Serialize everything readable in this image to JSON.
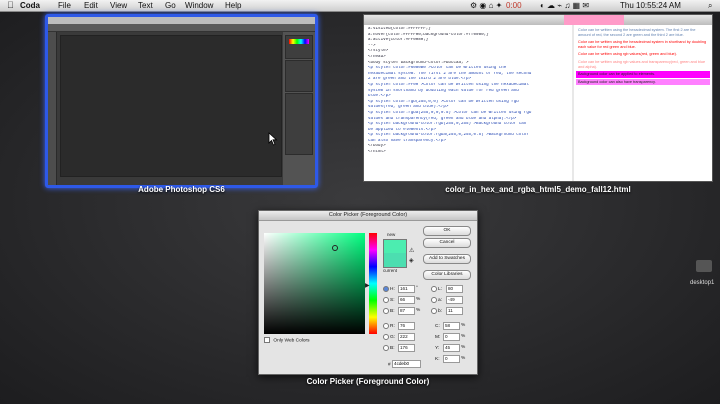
{
  "menubar": {
    "app": "Coda",
    "items": [
      "File",
      "Edit",
      "View",
      "Text",
      "Go",
      "Window",
      "Help"
    ],
    "status_text": "0:00",
    "clock": "Thu 10:55:24 AM"
  },
  "windows": {
    "photoshop": {
      "label": "Adobe Photoshop CS6"
    },
    "browser": {
      "label": "color_in_hex_and_rgba_html5_demo_fall12.html"
    }
  },
  "code_lines": [
    "a:visited{color:#FFFFFF;}",
    "a:hover{color:#FFFF00;background-color:#ff0080;}",
    "a:active{color:#FF0080;}",
    "-->",
    "</style>",
    "</head>",
    "<body style=\"background-color:#bbccaa;\">",
    "",
    "<p style=\"color:#6080B0\">Color can be written using the",
    "hexadecimal system. The first 2 are the amount of red, the second",
    "2 are green and the third 2 are blue.</p>",
    "",
    "<p style=\"color:#F00\">Color can be written using the hexadecimal",
    "system in shorthand by doubling each value for red green and",
    "blue.</p>",
    "",
    "<p style=\"color:rgb(255,0,0)\">Color can be written using rgb",
    "values(red, green and blue).</p>",
    "",
    "<p style=\"color:rgba(255,0,0,0.5)\">Color can be written using rgb",
    "values and transparency(red, green and blue and alpha).</p>",
    "",
    "<p style=\"background-color:rgb(255,0,255)\">Background color can",
    "be applied to elements.</p>",
    "",
    "<p style=\"background-color:rgba(255,0,255,0.5)\">Background color",
    "can also have transparency.</p>",
    "</body>",
    "</html>"
  ],
  "preview": [
    {
      "text": "Color can be written using the hexadecimal system. The first 2 are the amount of red, the second 2 are green and the third 2 are blue.",
      "color": "#6080b0",
      "bg": ""
    },
    {
      "text": "Color can be written using the hexadecimal system in shorthand by doubling each value for red green and blue.",
      "color": "#ff0000",
      "bg": ""
    },
    {
      "text": "Color can be written using rgb values(red, green and blue).",
      "color": "#ff0000",
      "bg": ""
    },
    {
      "text": "Color can be written using rgb values and transparency(red, green and blue and alpha).",
      "color": "#ff8080",
      "bg": ""
    },
    {
      "text": "Background color can be applied to elements.",
      "color": "#222222",
      "bg": "#ff00ff"
    },
    {
      "text": "Background color can also have transparency.",
      "color": "#222222",
      "bg": "#ff80ff"
    }
  ],
  "picker": {
    "title": "Color Picker (Foreground Color)",
    "caption": "Color Picker (Foreground Color)",
    "new_label": "new",
    "current_label": "current",
    "buttons": {
      "ok": "OK",
      "cancel": "Cancel",
      "add": "Add to Swatches",
      "libraries": "Color Libraries"
    },
    "hsb": [
      {
        "label": "H:",
        "value": "161",
        "unit": "°",
        "selected": true
      },
      {
        "label": "S:",
        "value": "66",
        "unit": "%",
        "selected": false
      },
      {
        "label": "B:",
        "value": "87",
        "unit": "%",
        "selected": false
      }
    ],
    "rgb": [
      {
        "label": "R:",
        "value": "76"
      },
      {
        "label": "G:",
        "value": "222"
      },
      {
        "label": "B:",
        "value": "176"
      }
    ],
    "lab": [
      {
        "label": "L:",
        "value": "80"
      },
      {
        "label": "a:",
        "value": "-49"
      },
      {
        "label": "b:",
        "value": "11"
      }
    ],
    "cmyk": [
      {
        "label": "C:",
        "value": "58",
        "unit": "%"
      },
      {
        "label": "M:",
        "value": "0",
        "unit": "%"
      },
      {
        "label": "Y:",
        "value": "45",
        "unit": "%"
      },
      {
        "label": "K:",
        "value": "0",
        "unit": "%"
      }
    ],
    "hex_label": "#",
    "hex_value": "4cdeb0",
    "web_only_label": "Only Web Colors",
    "new_color": "#4cedb0",
    "current_color": "#4cdeb0"
  },
  "desktop_items": [
    "desktop1"
  ]
}
